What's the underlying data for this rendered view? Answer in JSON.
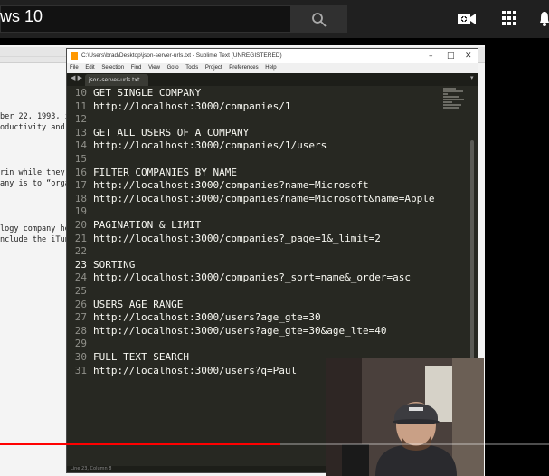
{
  "youtube": {
    "video_title_fragment": "ws 10",
    "progress_fraction": 0.51
  },
  "background_doc": {
    "title_bar_text": "",
    "snippets": [
      "ber 22, 1993, is",
      "oductivity and B",
      "rin while they w",
      "any is to “organ",
      "logy company he",
      "nclude the iTune"
    ]
  },
  "sublime": {
    "window_title": "C:\\Users\\brad\\Desktop\\json-server-urls.txt - Sublime Text (UNREGISTERED)",
    "menu": [
      "File",
      "Edit",
      "Selection",
      "Find",
      "View",
      "Goto",
      "Tools",
      "Project",
      "Preferences",
      "Help"
    ],
    "tab_label": "json-server-urls.txt",
    "current_line": 23,
    "lines": [
      {
        "n": "10",
        "t": "GET SINGLE COMPANY"
      },
      {
        "n": "11",
        "t": "http://localhost:3000/companies/1"
      },
      {
        "n": "12",
        "t": ""
      },
      {
        "n": "13",
        "t": "GET ALL USERS OF A COMPANY"
      },
      {
        "n": "14",
        "t": "http://localhost:3000/companies/1/users"
      },
      {
        "n": "15",
        "t": ""
      },
      {
        "n": "16",
        "t": "FILTER COMPANIES BY NAME"
      },
      {
        "n": "17",
        "t": "http://localhost:3000/companies?name=Microsoft"
      },
      {
        "n": "18",
        "t": "http://localhost:3000/companies?name=Microsoft&name=Apple"
      },
      {
        "n": "19",
        "t": ""
      },
      {
        "n": "20",
        "t": "PAGINATION & LIMIT"
      },
      {
        "n": "21",
        "t": "http://localhost:3000/companies?_page=1&_limit=2"
      },
      {
        "n": "22",
        "t": ""
      },
      {
        "n": "23",
        "t": "SORTING"
      },
      {
        "n": "24",
        "t": "http://localhost:3000/companies?_sort=name&_order=asc"
      },
      {
        "n": "25",
        "t": ""
      },
      {
        "n": "26",
        "t": "USERS AGE RANGE"
      },
      {
        "n": "27",
        "t": "http://localhost:3000/users?age_gte=30"
      },
      {
        "n": "28",
        "t": "http://localhost:3000/users?age_gte=30&age_lte=40"
      },
      {
        "n": "29",
        "t": ""
      },
      {
        "n": "30",
        "t": "FULL TEXT SEARCH"
      },
      {
        "n": "31",
        "t": "http://localhost:3000/users?q=Paul"
      }
    ],
    "status_text": "Line 23, Column 8"
  }
}
